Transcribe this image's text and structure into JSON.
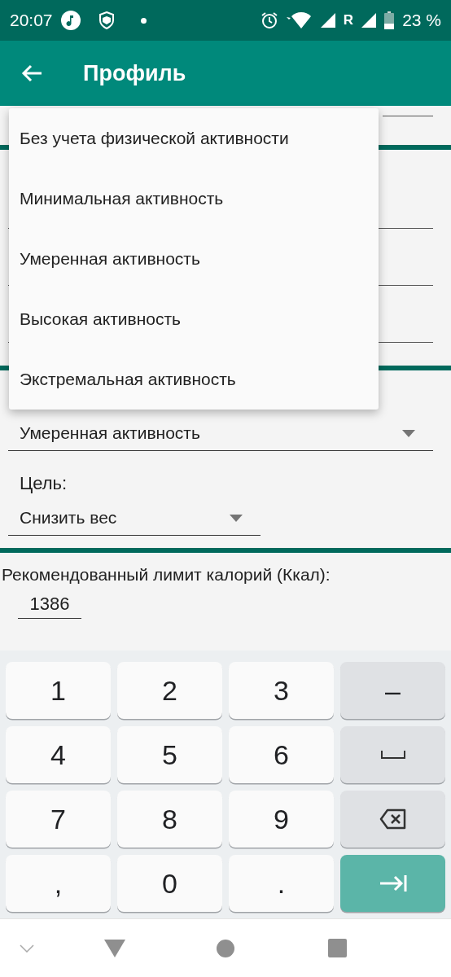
{
  "status_bar": {
    "time": "20:07",
    "roaming": "R",
    "battery": "23 %"
  },
  "app_bar": {
    "title": "Профиль"
  },
  "dropdown_menu": {
    "items": [
      {
        "label": "Без учета физической активности"
      },
      {
        "label": "Минимальная активность"
      },
      {
        "label": "Умеренная активность"
      },
      {
        "label": "Высокая активность"
      },
      {
        "label": "Экстремальная активность"
      }
    ]
  },
  "activity_spinner": {
    "value": "Умеренная активность"
  },
  "goal": {
    "label": "Цель:",
    "value": "Снизить вес"
  },
  "calorie_limit": {
    "label": "Рекомендованный лимит калорий (Ккал):",
    "value": "1386"
  },
  "keyboard": {
    "keys": [
      {
        "kind": "char",
        "label": "1"
      },
      {
        "kind": "char",
        "label": "2"
      },
      {
        "kind": "char",
        "label": "3"
      },
      {
        "kind": "function",
        "label": "–"
      },
      {
        "kind": "char",
        "label": "4"
      },
      {
        "kind": "char",
        "label": "5"
      },
      {
        "kind": "char",
        "label": "6"
      },
      {
        "kind": "space"
      },
      {
        "kind": "char",
        "label": "7"
      },
      {
        "kind": "char",
        "label": "8"
      },
      {
        "kind": "char",
        "label": "9"
      },
      {
        "kind": "backspace"
      },
      {
        "kind": "char",
        "label": ","
      },
      {
        "kind": "char",
        "label": "0"
      },
      {
        "kind": "char",
        "label": "."
      },
      {
        "kind": "next"
      }
    ]
  }
}
